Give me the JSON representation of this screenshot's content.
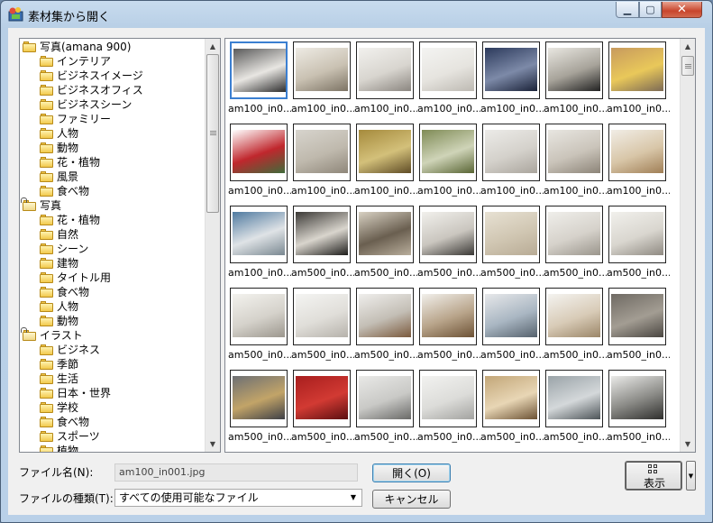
{
  "window": {
    "title": "素材集から開く",
    "minimize_icon": "minimize-icon",
    "maximize_icon": "maximize-icon",
    "close_icon": "close-icon"
  },
  "tree": {
    "items": [
      {
        "label": "写真(amana 900)",
        "level": 0,
        "type": "folder"
      },
      {
        "label": "インテリア",
        "level": 1,
        "type": "folder-open"
      },
      {
        "label": "ビジネスイメージ",
        "level": 1,
        "type": "folder"
      },
      {
        "label": "ビジネスオフィス",
        "level": 1,
        "type": "folder"
      },
      {
        "label": "ビジネスシーン",
        "level": 1,
        "type": "folder"
      },
      {
        "label": "ファミリー",
        "level": 1,
        "type": "folder"
      },
      {
        "label": "人物",
        "level": 1,
        "type": "folder"
      },
      {
        "label": "動物",
        "level": 1,
        "type": "folder"
      },
      {
        "label": "花・植物",
        "level": 1,
        "type": "folder"
      },
      {
        "label": "風景",
        "level": 1,
        "type": "folder"
      },
      {
        "label": "食べ物",
        "level": 1,
        "type": "folder"
      },
      {
        "label": "写真",
        "level": 0,
        "type": "locked-folder"
      },
      {
        "label": "花・植物",
        "level": 1,
        "type": "folder"
      },
      {
        "label": "自然",
        "level": 1,
        "type": "folder"
      },
      {
        "label": "シーン",
        "level": 1,
        "type": "folder"
      },
      {
        "label": "建物",
        "level": 1,
        "type": "folder"
      },
      {
        "label": "タイトル用",
        "level": 1,
        "type": "folder"
      },
      {
        "label": "食べ物",
        "level": 1,
        "type": "folder"
      },
      {
        "label": "人物",
        "level": 1,
        "type": "folder"
      },
      {
        "label": "動物",
        "level": 1,
        "type": "folder"
      },
      {
        "label": "イラスト",
        "level": 0,
        "type": "locked-folder"
      },
      {
        "label": "ビジネス",
        "level": 1,
        "type": "folder"
      },
      {
        "label": "季節",
        "level": 1,
        "type": "folder"
      },
      {
        "label": "生活",
        "level": 1,
        "type": "folder"
      },
      {
        "label": "日本・世界",
        "level": 1,
        "type": "folder"
      },
      {
        "label": "学校",
        "level": 1,
        "type": "folder"
      },
      {
        "label": "食べ物",
        "level": 1,
        "type": "folder"
      },
      {
        "label": "スポーツ",
        "level": 1,
        "type": "folder"
      },
      {
        "label": "植物",
        "level": 1,
        "type": "folder"
      }
    ],
    "scroll_up_icon": "scroll-up-arrow-icon",
    "scroll_down_icon": "scroll-down-arrow-icon"
  },
  "thumbnails": {
    "items": [
      {
        "caption": "am100_in0...",
        "selected": true,
        "colors": [
          "#5a5a5a",
          "#e8e6e2",
          "#2e2e2e"
        ]
      },
      {
        "caption": "am100_in0...",
        "colors": [
          "#eeebe4",
          "#c9c1b2",
          "#7d7465"
        ]
      },
      {
        "caption": "am100_in0...",
        "colors": [
          "#f2f1ee",
          "#d8d5cf",
          "#8b8680"
        ]
      },
      {
        "caption": "am100_in0...",
        "colors": [
          "#f4f4f2",
          "#e6e4df",
          "#bdb9b2"
        ]
      },
      {
        "caption": "am100_in0...",
        "colors": [
          "#2c3a5c",
          "#7d8aa8",
          "#1a2238"
        ]
      },
      {
        "caption": "am100_in0...",
        "colors": [
          "#e9e7e1",
          "#a7a39a",
          "#222222"
        ]
      },
      {
        "caption": "am100_in0...",
        "colors": [
          "#c79a5e",
          "#e9c85a",
          "#7c6a55"
        ]
      },
      {
        "caption": "am100_in0...",
        "colors": [
          "#ffffff",
          "#c0272d",
          "#3f6b3a"
        ]
      },
      {
        "caption": "am100_in0...",
        "colors": [
          "#d7d4cd",
          "#bfb9ad",
          "#8f877a"
        ]
      },
      {
        "caption": "am100_in0...",
        "colors": [
          "#a58a3c",
          "#d3c07a",
          "#5f4c26"
        ]
      },
      {
        "caption": "am100_in0...",
        "colors": [
          "#7f8b56",
          "#cfd4b8",
          "#596534"
        ]
      },
      {
        "caption": "am100_in0...",
        "colors": [
          "#ecebe8",
          "#d4d1cb",
          "#aaa59d"
        ]
      },
      {
        "caption": "am100_in0...",
        "colors": [
          "#e8e6e1",
          "#cac4ba",
          "#8c8478"
        ]
      },
      {
        "caption": "am100_in0...",
        "colors": [
          "#f1ede6",
          "#d8c6a8",
          "#a07f56"
        ]
      },
      {
        "caption": "am100_in0...",
        "colors": [
          "#4f7aa0",
          "#dfe3e6",
          "#7a8891"
        ]
      },
      {
        "caption": "am500_in0...",
        "colors": [
          "#3b3936",
          "#d9d5cd",
          "#1e1d1b"
        ]
      },
      {
        "caption": "am500_in0...",
        "colors": [
          "#d8d1c3",
          "#6a5f50",
          "#b9ae9c"
        ]
      },
      {
        "caption": "am500_in0...",
        "colors": [
          "#f1f0ec",
          "#cac6bf",
          "#3a3835"
        ]
      },
      {
        "caption": "am500_in0...",
        "colors": [
          "#e7e1d3",
          "#d0c6b2",
          "#b8ab95"
        ]
      },
      {
        "caption": "am500_in0...",
        "colors": [
          "#efeeea",
          "#d6d2cb",
          "#9a958c"
        ]
      },
      {
        "caption": "am500_in0...",
        "colors": [
          "#f1f0ec",
          "#d9d6cf",
          "#8f8a82"
        ]
      },
      {
        "caption": "am500_in0...",
        "colors": [
          "#f3f2ee",
          "#d5d2cb",
          "#9c978e"
        ]
      },
      {
        "caption": "am500_in0...",
        "colors": [
          "#f4f4f2",
          "#e0ded9",
          "#b6b2ab"
        ]
      },
      {
        "caption": "am500_in0...",
        "colors": [
          "#efeeec",
          "#c3beb5",
          "#7b5a3d"
        ]
      },
      {
        "caption": "am500_in0...",
        "colors": [
          "#f1efeb",
          "#b8a48a",
          "#6d5235"
        ]
      },
      {
        "caption": "am500_in0...",
        "colors": [
          "#e7e8ea",
          "#a9b6c2",
          "#56626d"
        ]
      },
      {
        "caption": "am500_in0...",
        "colors": [
          "#f4f3f0",
          "#d8cbb7",
          "#9b8668"
        ]
      },
      {
        "caption": "am500_in0...",
        "colors": [
          "#6f6a63",
          "#a39d93",
          "#4a4641"
        ]
      },
      {
        "caption": "am500_in0...",
        "colors": [
          "#6d6f74",
          "#c2a468",
          "#3e4046"
        ]
      },
      {
        "caption": "am500_in0...",
        "colors": [
          "#a81e1e",
          "#d23a33",
          "#5c0f10"
        ]
      },
      {
        "caption": "am500_in0...",
        "colors": [
          "#e9e9e7",
          "#c9c9c6",
          "#6a6a68"
        ]
      },
      {
        "caption": "am500_in0...",
        "colors": [
          "#f2f2f0",
          "#dcdcd9",
          "#a3a3a0"
        ]
      },
      {
        "caption": "am500_in0...",
        "colors": [
          "#c2a678",
          "#e8d6b5",
          "#6c5234"
        ]
      },
      {
        "caption": "am500_in0...",
        "colors": [
          "#9aa3a8",
          "#d4d8da",
          "#4d5458"
        ]
      },
      {
        "caption": "am500_in0...",
        "colors": [
          "#eaeae8",
          "#8a8a86",
          "#2f2f2d"
        ]
      }
    ],
    "scroll_up_icon": "scroll-up-arrow-icon",
    "scroll_down_icon": "scroll-down-arrow-icon"
  },
  "form": {
    "filename_label": "ファイル名(N):",
    "filename_value": "am100_in001.jpg",
    "filetype_label": "ファイルの種類(T):",
    "filetype_value": "すべての使用可能なファイル",
    "open_button": "開く(O)",
    "cancel_button": "キャンセル",
    "view_button": "表示",
    "view_icon": "thumbnail-view-icon",
    "view_dropdown_icon": "dropdown-arrow-icon"
  }
}
